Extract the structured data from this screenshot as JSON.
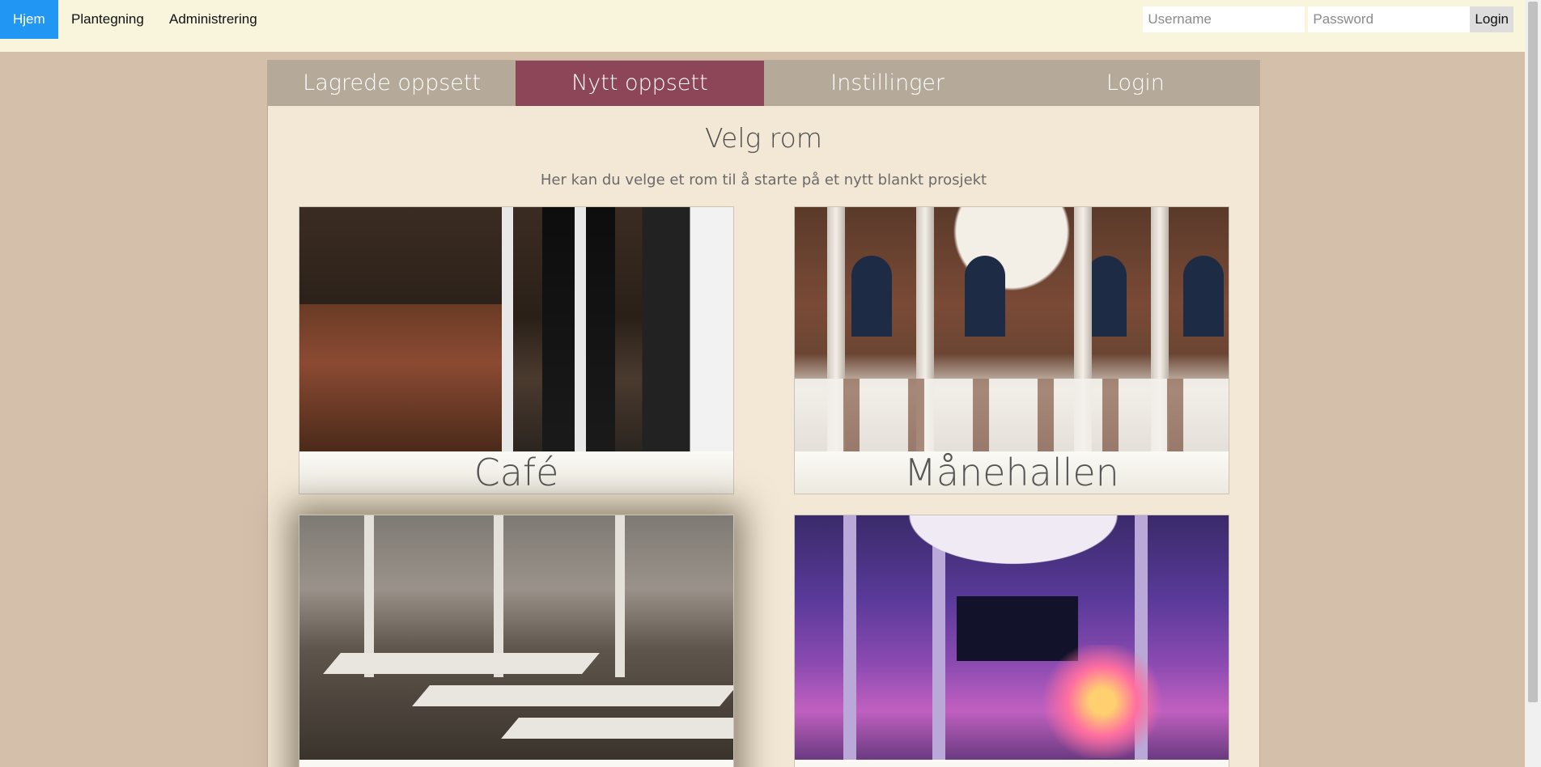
{
  "topnav": {
    "links": [
      {
        "label": "Hjem",
        "active": true
      },
      {
        "label": "Plantegning",
        "active": false
      },
      {
        "label": "Administrering",
        "active": false
      }
    ],
    "login": {
      "username_placeholder": "Username",
      "password_placeholder": "Password",
      "button_label": "Login"
    }
  },
  "panel": {
    "tabs": [
      {
        "label": "Lagrede oppsett",
        "active": false
      },
      {
        "label": "Nytt oppsett",
        "active": true
      },
      {
        "label": "Instillinger",
        "active": false
      },
      {
        "label": "Login",
        "active": false
      }
    ],
    "heading": "Velg rom",
    "subheading": "Her kan du velge et rom til å starte på et nytt blankt prosjekt",
    "rooms": [
      {
        "name": "Café",
        "image": "cafe-photo"
      },
      {
        "name": "Månehallen",
        "image": "manehallen-photo"
      },
      {
        "name": "",
        "image": "banquet-hall-photo"
      },
      {
        "name": "",
        "image": "concert-hall-photo"
      }
    ]
  },
  "colors": {
    "page_bg": "#d3bfaa",
    "nav_bg": "#f8f5dc",
    "nav_active": "#2196f3",
    "tab_bg": "#b5aa9a",
    "tab_active": "#8d4558",
    "panel_bg": "#f2e8d5"
  }
}
